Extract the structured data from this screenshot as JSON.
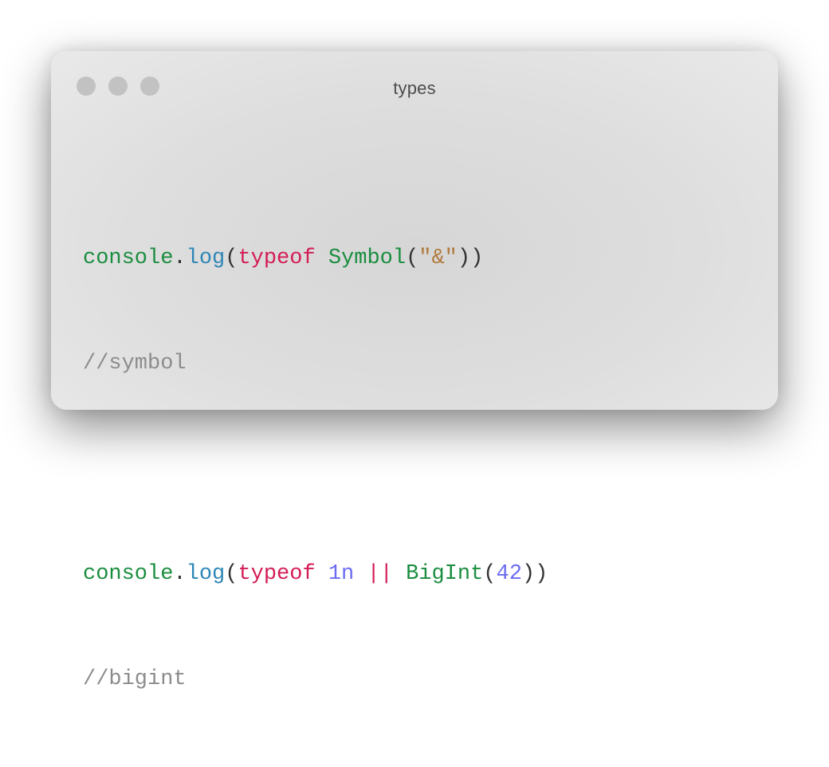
{
  "window": {
    "title": "types"
  },
  "code": {
    "line1": {
      "obj": "console",
      "dot": ".",
      "method": "log",
      "open": "(",
      "keyword": "typeof",
      "space": " ",
      "call": "Symbol",
      "open2": "(",
      "string": "\"&\"",
      "close": "))"
    },
    "line2": {
      "comment": "//symbol"
    },
    "line4": {
      "obj": "console",
      "dot": ".",
      "method": "log",
      "open": "(",
      "keyword": "typeof",
      "space": " ",
      "literal": "1n",
      "operator": "||",
      "call": "BigInt",
      "open2": "(",
      "number": "42",
      "close": "))"
    },
    "line5": {
      "comment": "//bigint"
    }
  },
  "colors": {
    "identifier": "#1a8d3f",
    "method": "#2e86b6",
    "keyword": "#d31d55",
    "string": "#b07a3c",
    "number": "#6b6cf0",
    "comment": "#8c8c8c",
    "traffic_light": "#c2c2c2"
  }
}
